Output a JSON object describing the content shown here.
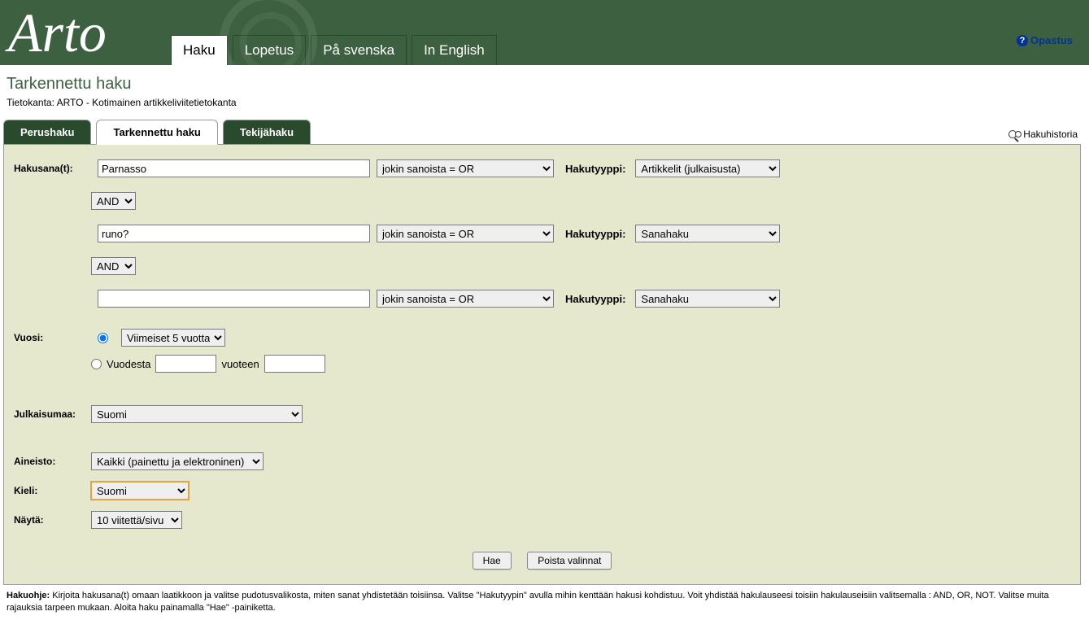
{
  "logo": "Arto",
  "mainTabs": {
    "haku": "Haku",
    "lopetus": "Lopetus",
    "svenska": "På svenska",
    "english": "In English"
  },
  "help": "Opastus",
  "pageTitle": "Tarkennettu haku",
  "dbInfo": "Tietokanta: ARTO - Kotimainen artikkeliviitetietokanta",
  "subTabs": {
    "perushaku": "Perushaku",
    "tarkennettu": "Tarkennettu haku",
    "tekijahaku": "Tekijähaku"
  },
  "historyLink": "Hakuhistoria",
  "labels": {
    "hakusanat": "Hakusana(t):",
    "hakutyyppi": "Hakutyyppi:",
    "vuosi": "Vuosi:",
    "vuodesta": "Vuodesta",
    "vuoteen": "vuoteen",
    "julkaisumaa": "Julkaisumaa:",
    "aineisto": "Aineisto:",
    "kieli": "Kieli:",
    "nayta": "Näytä:"
  },
  "search": {
    "term1": "Parnasso",
    "combine1": "jokin sanoista = OR",
    "type1": "Artikkelit (julkaisusta)",
    "bool1": "AND",
    "term2": "runo?",
    "combine2": "jokin sanoista = OR",
    "type2": "Sanahaku",
    "bool2": "AND",
    "term3": "",
    "combine3": "jokin sanoista = OR",
    "type3": "Sanahaku"
  },
  "year": {
    "preset": "Viimeiset 5 vuotta",
    "from": "",
    "to": ""
  },
  "julkaisumaa": "Suomi",
  "aineisto": "Kaikki (painettu ja elektroninen)",
  "kieli": "Suomi",
  "nayta": "10 viitettä/sivu",
  "buttons": {
    "hae": "Hae",
    "poista": "Poista valinnat"
  },
  "hint": {
    "label": "Hakuohje:",
    "text": " Kirjoita hakusana(t) omaan laatikkoon ja valitse pudotusvalikosta, miten sanat yhdistetään toisiinsa. Valitse \"Hakutyypin\" avulla mihin kenttään hakusi kohdistuu. Voit yhdistää hakulauseesi toisiin hakulauseisiin valitsemalla : AND, OR, NOT. Valitse muita rajauksia tarpeen mukaan. Aloita haku painamalla \"Hae\" -painiketta."
  }
}
